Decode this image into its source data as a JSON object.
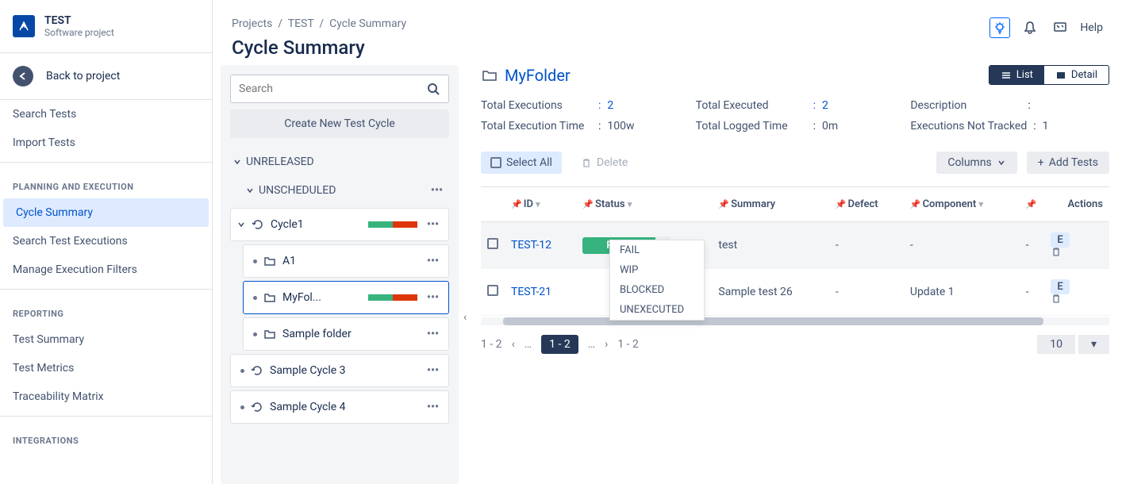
{
  "project": {
    "name": "TEST",
    "type": "Software project"
  },
  "back": "Back to project",
  "sidebar": {
    "simple": [
      "Search Tests",
      "Import Tests"
    ],
    "planning_head": "PLANNING AND EXECUTION",
    "planning": [
      "Cycle Summary",
      "Search Test Executions",
      "Manage Execution Filters"
    ],
    "reporting_head": "REPORTING",
    "reporting": [
      "Test Summary",
      "Test Metrics",
      "Traceability Matrix"
    ],
    "integrations_head": "INTEGRATIONS"
  },
  "breadcrumbs": [
    "Projects",
    "TEST",
    "Cycle Summary"
  ],
  "page_title": "Cycle Summary",
  "help": "Help",
  "search_ph": "Search",
  "create_cycle": "Create New Test Cycle",
  "tree": {
    "unreleased": "UNRELEASED",
    "unscheduled": "UNSCHEDULED",
    "cycle1": "Cycle1",
    "a1": "A1",
    "myfolder": "MyFol...",
    "sample_folder": "Sample folder",
    "sample_cycle_3": "Sample Cycle 3",
    "sample_cycle_4": "Sample Cycle 4"
  },
  "folder_title": "MyFolder",
  "views": {
    "list": "List",
    "detail": "Detail"
  },
  "stats": {
    "total_exec_l": "Total Executions",
    "total_exec_v": "2",
    "total_executed_l": "Total Executed",
    "total_executed_v": "2",
    "description_l": "Description",
    "description_v": "",
    "total_time_l": "Total Execution Time",
    "total_time_v": "100w",
    "logged_l": "Total Logged Time",
    "logged_v": "0m",
    "not_tracked_l": "Executions Not Tracked",
    "not_tracked_v": "1"
  },
  "actions": {
    "select_all": "Select All",
    "delete": "Delete",
    "columns": "Columns",
    "add_tests": "Add Tests"
  },
  "table": {
    "headers": {
      "id": "ID",
      "status": "Status",
      "summary": "Summary",
      "defect": "Defect",
      "component": "Component",
      "actions": "Actions"
    },
    "rows": [
      {
        "id": "TEST-12",
        "status": "PASS",
        "summary": "test",
        "defect": "-",
        "component": "-",
        "extra": "-",
        "e": "E"
      },
      {
        "id": "TEST-21",
        "summary": "Sample test 26",
        "defect": "-",
        "component": "Update 1",
        "extra": "-",
        "e": "E"
      }
    ],
    "status_options": [
      "FAIL",
      "WIP",
      "BLOCKED",
      "UNEXECUTED"
    ]
  },
  "pager": {
    "range": "1 - 2",
    "current": "1 - 2",
    "range2": "1 - 2",
    "size": "10"
  }
}
